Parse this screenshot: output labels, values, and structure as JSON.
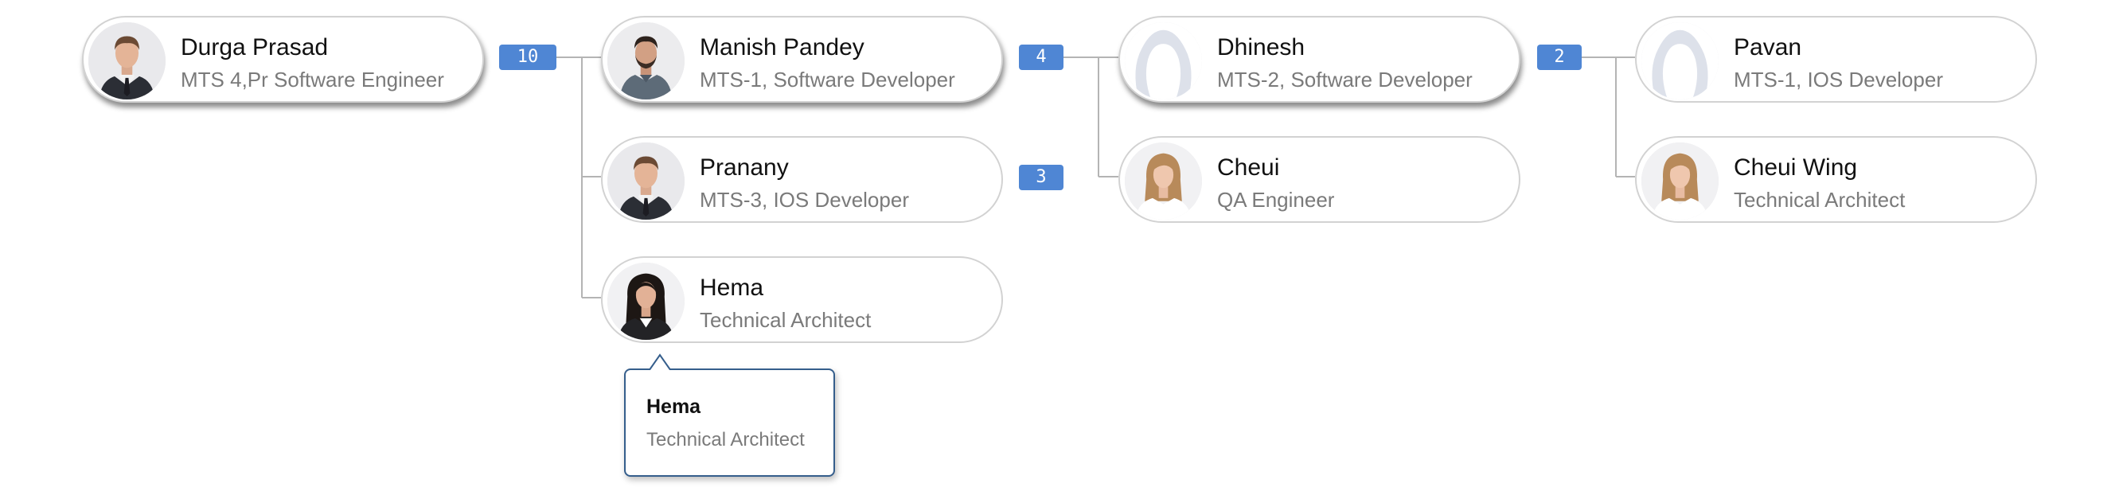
{
  "nodes": {
    "durga": {
      "name": "Durga Prasad",
      "title": "MTS 4,Pr Software Engineer",
      "avatar": "man-suit-avatar",
      "badge": "10"
    },
    "manish": {
      "name": "Manish Pandey",
      "title": "MTS-1, Software Developer",
      "avatar": "man-casual-avatar",
      "badge": "4"
    },
    "pranany": {
      "name": "Pranany",
      "title": "MTS-3, IOS Developer",
      "avatar": "man-suit-avatar",
      "badge": "3"
    },
    "hema": {
      "name": "Hema",
      "title": "Technical Architect",
      "avatar": "woman-dark-hair-avatar"
    },
    "dhinesh": {
      "name": "Dhinesh",
      "title": "MTS-2, Software Developer",
      "avatar": "placeholder-avatar",
      "badge": "2"
    },
    "cheui": {
      "name": "Cheui",
      "title": "QA Engineer",
      "avatar": "woman-blonde-avatar"
    },
    "pavan": {
      "name": "Pavan",
      "title": "MTS-1, IOS Developer",
      "avatar": "placeholder-avatar"
    },
    "cheui_wing": {
      "name": "Cheui Wing",
      "title": "Technical Architect",
      "avatar": "woman-blonde-avatar"
    }
  },
  "tooltip": {
    "name": "Hema",
    "title": "Technical Architect"
  },
  "colors": {
    "badge": "#4f86d4",
    "connector": "#b4b4b4",
    "node_border": "#d2d2d2",
    "tooltip_border": "#355e8c"
  }
}
